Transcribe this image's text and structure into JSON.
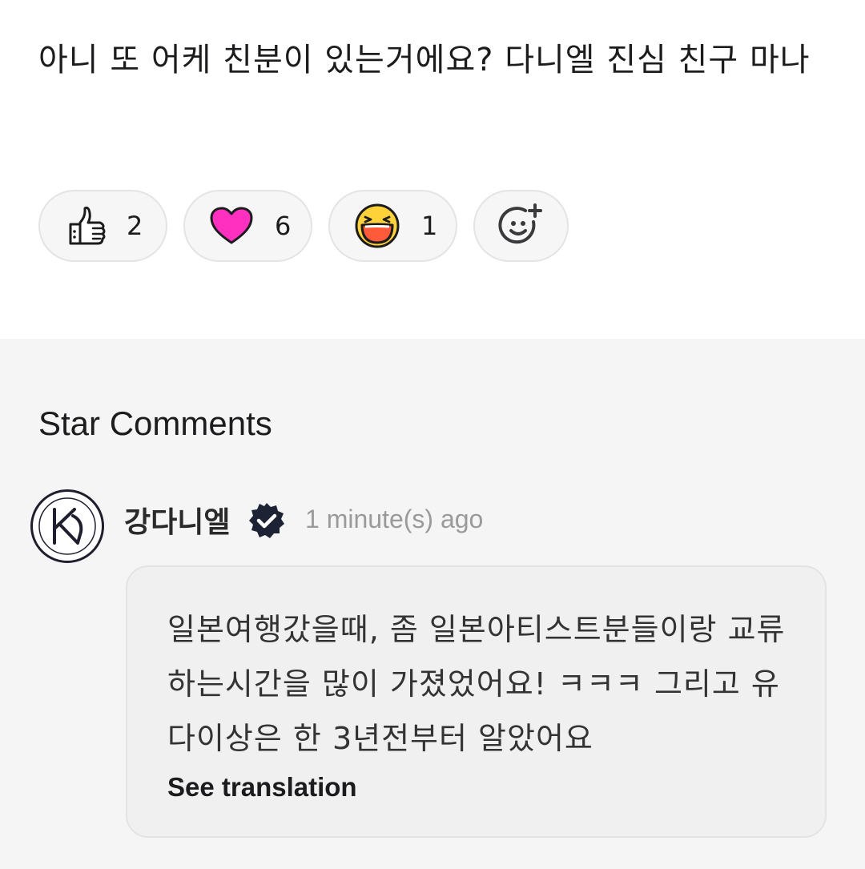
{
  "post": {
    "text": "아니 또 어케 친분이 있는거에요? 다니엘 진심 친구 마나"
  },
  "reactions": [
    {
      "icon": "thumbs-up-icon",
      "count": "2"
    },
    {
      "icon": "heart-icon",
      "count": "6",
      "color": "#ff2fc0"
    },
    {
      "icon": "laughing-face-icon",
      "count": "1",
      "color": "#ffd23a"
    }
  ],
  "add_reaction_icon": "add-emoji-icon",
  "star_comments": {
    "title": "Star Comments",
    "comment": {
      "author": "강다니엘",
      "verified_icon": "verified-badge-icon",
      "time": "1 minute(s) ago",
      "text": "일본여행갔을때, 좀 일본아티스트분들이랑 교류하는시간을 많이 가졌었어요! ㅋㅋㅋ 그리고 유다이상은 한 3년전부터 알았어요",
      "see_translation": "See translation"
    }
  },
  "colors": {
    "section_bg": "#f5f5f5",
    "bubble_bg": "#f0f0f0",
    "heart": "#ff2fc0",
    "laugh_face": "#ffd23a",
    "laugh_mouth": "#ff5a3a"
  }
}
